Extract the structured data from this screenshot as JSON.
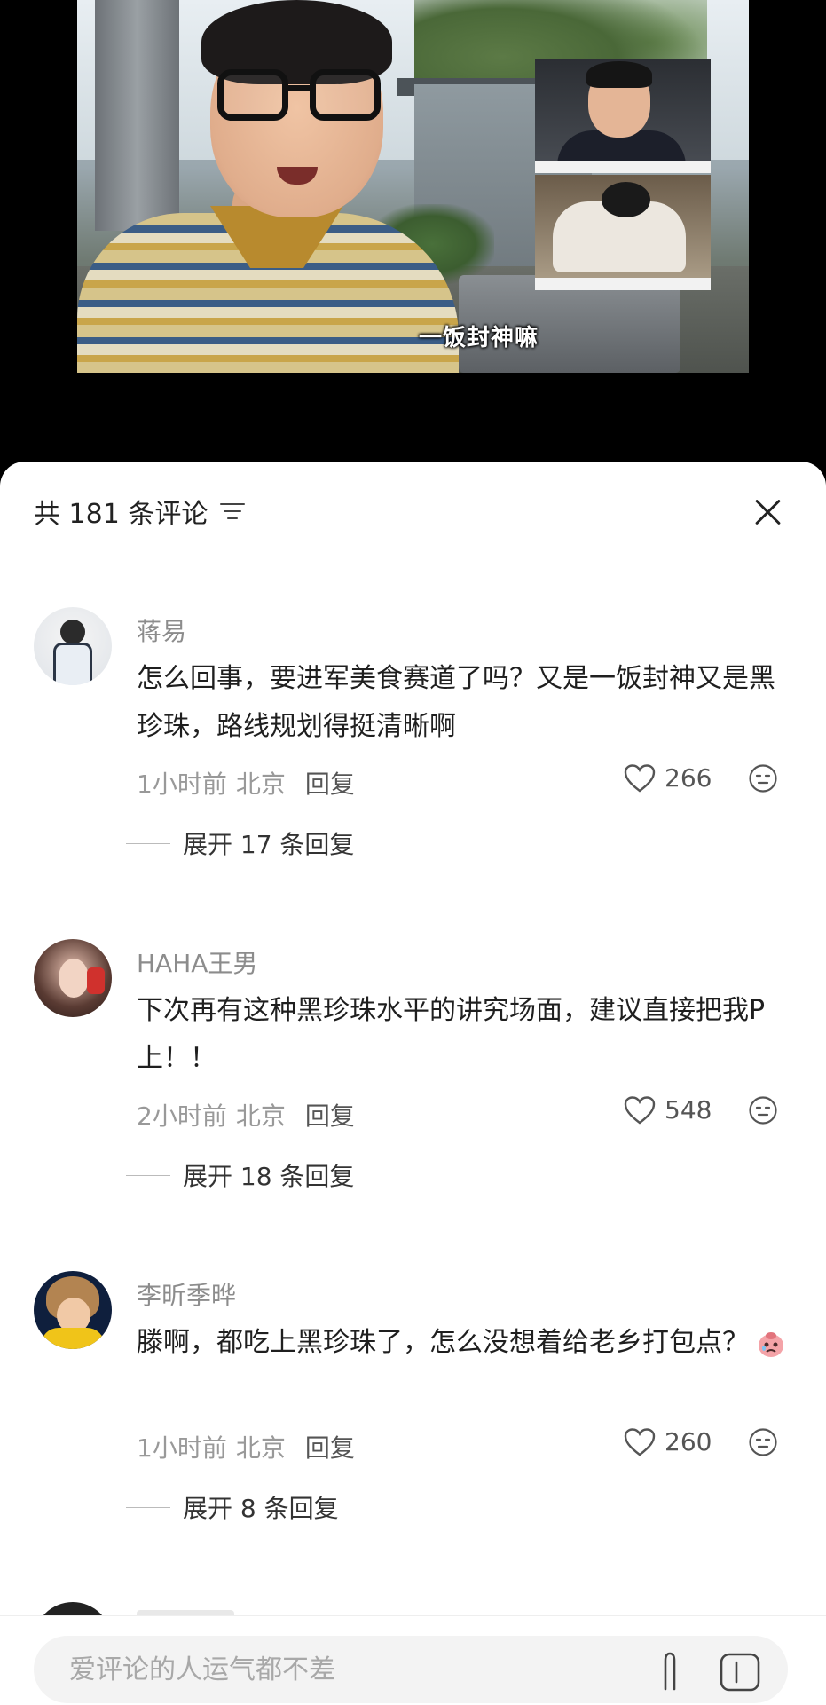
{
  "video": {
    "subtitle": "一饭封神嘛"
  },
  "comments_panel": {
    "title": "共 181 条评论",
    "input_placeholder": "爱评论的人运气都不差"
  },
  "comments": [
    {
      "name": "蒋易",
      "text": "怎么回事，要进军美食赛道了吗？又是一饭封神又是黑珍珠，路线规划得挺清晰啊",
      "time": "1小时前",
      "location": "北京",
      "reply_label": "回复",
      "likes": "266",
      "expand_label": "展开 17 条回复"
    },
    {
      "name": "HAHA王男",
      "text": "下次再有这种黑珍珠水平的讲究场面，建议直接把我P上！！",
      "time": "2小时前",
      "location": "北京",
      "reply_label": "回复",
      "likes": "548",
      "expand_label": "展开 18 条回复"
    },
    {
      "name": "李昕季晔",
      "text": "滕啊，都吃上黑珍珠了，怎么没想着给老乡打包点？",
      "time": "1小时前",
      "location": "北京",
      "reply_label": "回复",
      "likes": "260",
      "expand_label": "展开 8 条回复"
    }
  ],
  "colors": {
    "sheet_bg": "#ffffff",
    "name_gray": "#8c8c8c",
    "text_dark": "#1f1f1f"
  }
}
